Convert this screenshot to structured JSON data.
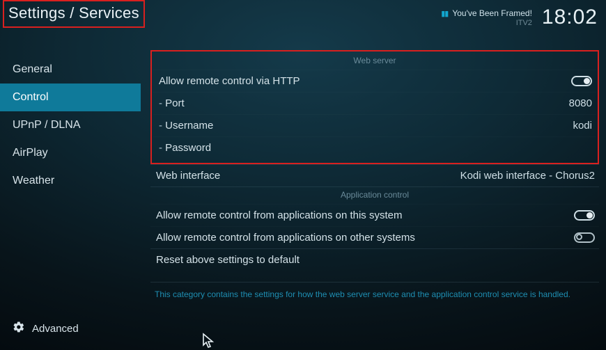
{
  "breadcrumb": "Settings / Services",
  "now_playing": {
    "title": "You've Been Framed!",
    "channel": "ITV2"
  },
  "clock": "18:02",
  "sidebar": {
    "items": [
      {
        "label": "General"
      },
      {
        "label": "Control"
      },
      {
        "label": "UPnP / DLNA"
      },
      {
        "label": "AirPlay"
      },
      {
        "label": "Weather"
      }
    ],
    "level_label": "Advanced"
  },
  "sections": {
    "web_server_heading": "Web server",
    "app_control_heading": "Application control"
  },
  "settings": {
    "allow_http": {
      "label": "Allow remote control via HTTP",
      "on": true
    },
    "port": {
      "label": "Port",
      "value": "8080"
    },
    "username": {
      "label": "Username",
      "value": "kodi"
    },
    "password": {
      "label": "Password",
      "value": ""
    },
    "web_interface": {
      "label": "Web interface",
      "value": "Kodi web interface - Chorus2"
    },
    "allow_local_apps": {
      "label": "Allow remote control from applications on this system",
      "on": true
    },
    "allow_remote_apps": {
      "label": "Allow remote control from applications on other systems",
      "on": false
    },
    "reset": {
      "label": "Reset above settings to default"
    }
  },
  "footer_hint": "This category contains the settings for how the web server service and the application control service is handled."
}
